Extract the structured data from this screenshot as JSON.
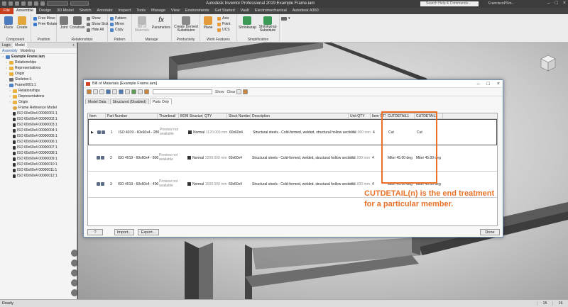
{
  "window": {
    "title": "Autodesk Inventor Professional 2019   Example Frame.iam",
    "search_placeholder": "Search Help & Commands...",
    "user": "FranciscoPSm..."
  },
  "ribbon_tabs": [
    "File",
    "Assemble",
    "Design",
    "3D Model",
    "Sketch",
    "Annotate",
    "Inspect",
    "Tools",
    "Manage",
    "View",
    "Environments",
    "Get Started",
    "Vault",
    "Electromechanical",
    "Autodesk A360"
  ],
  "active_tab": "Assemble",
  "ribbon": {
    "component": {
      "name": "Component",
      "place": "Place",
      "create": "Create"
    },
    "position": {
      "name": "Position",
      "free_move": "Free Move",
      "free_rotate": "Free Rotate"
    },
    "relationships": {
      "name": "Relationships",
      "joint": "Joint",
      "constrain": "Constrain",
      "show": "Show",
      "show_sick": "Show Sick",
      "hide_all": "Hide All"
    },
    "pattern": {
      "name": "Pattern",
      "pattern": "Pattern",
      "mirror": "Mirror",
      "copy": "Copy"
    },
    "manage": {
      "name": "Manage",
      "bom": "Bill of Materials",
      "parameters": "Parameters"
    },
    "productivity": {
      "name": "Productivity",
      "derived": "Create Derived Substitutes"
    },
    "work_features": {
      "name": "Work Features",
      "plane": "Plane",
      "axis": "Axis",
      "point": "Point",
      "ucs": "UCS"
    },
    "simplification": {
      "name": "Simplification",
      "shrinkwrap": "Shrinkwrap",
      "substitute": "Shrinkwrap Substitute"
    }
  },
  "browser": {
    "tabs": [
      "Logic",
      "Model"
    ],
    "plus": "+",
    "sub": [
      "Assembly",
      "Modeling"
    ],
    "tree": [
      {
        "label": "Example Frame.iam",
        "icon": "a",
        "indent": 0,
        "bold": true
      },
      {
        "label": "Relationships",
        "icon": "f",
        "indent": 1
      },
      {
        "label": "Representations",
        "icon": "f",
        "indent": 1
      },
      {
        "label": "Origin",
        "icon": "f",
        "indent": 1
      },
      {
        "label": "Skeleton:1",
        "icon": "p",
        "indent": 1
      },
      {
        "label": "Frame0001:1",
        "icon": "a",
        "indent": 1
      },
      {
        "label": "Relationships",
        "icon": "f",
        "indent": 2
      },
      {
        "label": "Representations",
        "icon": "f",
        "indent": 2
      },
      {
        "label": "Origin",
        "icon": "f",
        "indent": 2
      },
      {
        "label": "Frame Reference Model",
        "icon": "o",
        "indent": 2
      },
      {
        "label": "ISO 60x60x4 00000001:1",
        "icon": "i",
        "indent": 2
      },
      {
        "label": "ISO 60x60x4 00000002:1",
        "icon": "i",
        "indent": 2
      },
      {
        "label": "ISO 60x60x4 00000003:1",
        "icon": "i",
        "indent": 2
      },
      {
        "label": "ISO 60x60x4 00000004:1",
        "icon": "i",
        "indent": 2
      },
      {
        "label": "ISO 60x60x4 00000005:1",
        "icon": "i",
        "indent": 2
      },
      {
        "label": "ISO 60x60x4 00000006:1",
        "icon": "i",
        "indent": 2
      },
      {
        "label": "ISO 60x60x4 00000007:1",
        "icon": "i",
        "indent": 2
      },
      {
        "label": "ISO 60x60x4 00000008:1",
        "icon": "i",
        "indent": 2
      },
      {
        "label": "ISO 60x60x4 00000009:1",
        "icon": "i",
        "indent": 2
      },
      {
        "label": "ISO 60x60x4 00000010:1",
        "icon": "i",
        "indent": 2
      },
      {
        "label": "ISO 60x60x4 00000011:1",
        "icon": "i",
        "indent": 2
      },
      {
        "label": "ISO 60x60x4 00000012:1",
        "icon": "i",
        "indent": 2
      }
    ]
  },
  "bom": {
    "title": "Bill of Materials [Example Frame.iam]",
    "toolbar": {
      "show": "Show",
      "clear": "Clear"
    },
    "tabs": [
      "Model Data",
      "Structured (Disabled)",
      "Parts Only"
    ],
    "active_tab": "Parts Only",
    "columns": [
      "Item",
      "Part Number",
      "Thumbnail",
      "BOM Structure",
      "QTY",
      "Stock Number",
      "Description",
      "Unit QTY",
      "Item QTY",
      "CUTDETAIL1",
      "CUTDETAIL2"
    ],
    "rows": [
      {
        "item": "1",
        "part_number": "ISO 4019 - 60x60x4 - 280",
        "thumbnail": "Preview not available",
        "bom_structure": "Normal",
        "qty": "1120.000 mm",
        "stock_number": "60x60x4",
        "description": "Structural steels - Cold-formed, welded, structural hollow sections",
        "unit_qty": "280.000 mm",
        "item_qty": "4",
        "cutdetail1": "Cut",
        "cutdetail2": "Cut"
      },
      {
        "item": "2",
        "part_number": "ISO 4019 - 60x60x4 - 800",
        "thumbnail": "Preview not available",
        "bom_structure": "Normal",
        "qty": "3200.000 mm",
        "stock_number": "60x60x4",
        "description": "Structural steels - Cold-formed, welded, structural hollow sections",
        "unit_qty": "800.000 mm",
        "item_qty": "4",
        "cutdetail1": "Miter 45.00 deg",
        "cutdetail2": "Miter 45.00 deg"
      },
      {
        "item": "3",
        "part_number": "ISO 4019 - 60x60x4 - 400",
        "thumbnail": "Preview not available",
        "bom_structure": "Normal",
        "qty": "1600.000 mm",
        "stock_number": "60x60x4",
        "description": "Structural steels - Cold-formed, welded, structural hollow sections",
        "unit_qty": "400.000 mm",
        "item_qty": "4",
        "cutdetail1": "Miter 45.00 deg",
        "cutdetail2": "Miter 45.00 deg"
      }
    ],
    "buttons": {
      "help": "?",
      "import": "Import...",
      "export": "Export...",
      "done": "Done"
    }
  },
  "annotation": {
    "line1": "CUTDETAIL(n) is the end treatment",
    "line2": "for a particular member.",
    "color": "#e8722a"
  },
  "status": {
    "text": "Ready",
    "n1": "15",
    "n2": "16"
  }
}
